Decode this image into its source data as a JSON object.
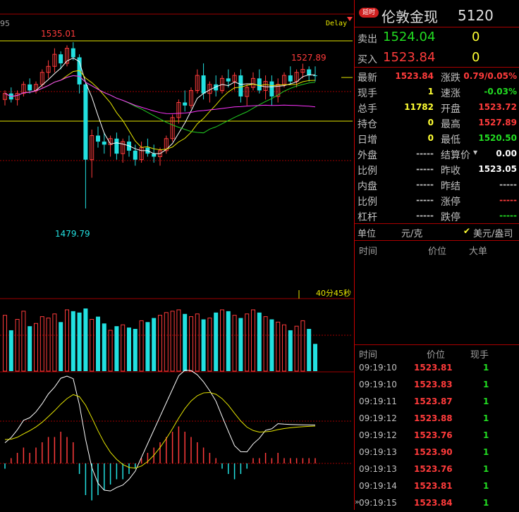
{
  "header": {
    "delay_badge": "延时",
    "instrument_name": "伦敦金现",
    "instrument_code": "5120",
    "delay_label": "Delay",
    "left_axis_fragment": "95"
  },
  "quotes": {
    "sell_label": "卖出",
    "sell_price": "1524.04",
    "sell_qty": "0",
    "buy_label": "买入",
    "buy_price": "1523.84",
    "buy_qty": "0"
  },
  "stats": {
    "left": [
      {
        "label": "最新",
        "value": "1523.84",
        "color": "#ff3b3b"
      },
      {
        "label": "现手",
        "value": "1",
        "color": "#ffff33"
      },
      {
        "label": "总手",
        "value": "11782",
        "color": "#ffff33"
      },
      {
        "label": "持仓",
        "value": "0",
        "color": "#ffff33"
      },
      {
        "label": "日增",
        "value": "0",
        "color": "#ffff33"
      },
      {
        "label": "外盘",
        "value": "-----",
        "color": "#c0c0c0"
      },
      {
        "label": "比例",
        "value": "-----",
        "color": "#c0c0c0"
      },
      {
        "label": "内盘",
        "value": "-----",
        "color": "#c0c0c0"
      },
      {
        "label": "比例",
        "value": "-----",
        "color": "#c0c0c0"
      },
      {
        "label": "杠杆",
        "value": "-----",
        "color": "#c0c0c0"
      }
    ],
    "right": [
      {
        "label": "涨跌",
        "value": "0.79/0.05%",
        "color": "#ff3b3b"
      },
      {
        "label": "速涨",
        "value": "-0.03%",
        "color": "#22dd22"
      },
      {
        "label": "开盘",
        "value": "1523.72",
        "color": "#ff3b3b"
      },
      {
        "label": "最高",
        "value": "1527.89",
        "color": "#ff3b3b"
      },
      {
        "label": "最低",
        "value": "1520.50",
        "color": "#22dd22"
      },
      {
        "label": "结算价",
        "value": "0.00",
        "color": "#ffffff"
      },
      {
        "label": "昨收",
        "value": "1523.05",
        "color": "#ffffff"
      },
      {
        "label": "昨结",
        "value": "-----",
        "color": "#c0c0c0"
      },
      {
        "label": "涨停",
        "value": "-----",
        "color": "#ff3b3b"
      },
      {
        "label": "跌停",
        "value": "-----",
        "color": "#22dd22"
      }
    ]
  },
  "unit_bar": {
    "unit_label": "单位",
    "unit_value": "元/克",
    "check": "✔",
    "alt_unit": "美元/盎司"
  },
  "big_orders": {
    "headers": [
      "时间",
      "价位",
      "大单"
    ]
  },
  "ticks": {
    "headers": [
      "时间",
      "价位",
      "现手"
    ],
    "rows": [
      {
        "time": "09:19:10",
        "price": "1523.81",
        "qty": "1"
      },
      {
        "time": "09:19:10",
        "price": "1523.83",
        "qty": "1"
      },
      {
        "time": "09:19:11",
        "price": "1523.87",
        "qty": "1"
      },
      {
        "time": "09:19:12",
        "price": "1523.88",
        "qty": "1"
      },
      {
        "time": "09:19:12",
        "price": "1523.76",
        "qty": "1"
      },
      {
        "time": "09:19:13",
        "price": "1523.90",
        "qty": "1"
      },
      {
        "time": "09:19:13",
        "price": "1523.76",
        "qty": "1"
      },
      {
        "time": "09:19:14",
        "price": "1523.81",
        "qty": "1"
      },
      {
        "time": "09:19:15",
        "price": "1523.84",
        "qty": "1"
      }
    ]
  },
  "chart": {
    "high_label": "1535.01",
    "low_label": "1479.79",
    "recent_high_label": "1527.89",
    "countdown": "40分45秒",
    "colors": {
      "up": "#ff3b3b",
      "down": "#22e0e0",
      "ma_white": "#ffffff",
      "ma_yellow": "#e6e600",
      "ma_green": "#22cc22",
      "ma_magenta": "#ff33ff",
      "grid": "#a00000"
    }
  },
  "chart_data": {
    "type": "candlestick",
    "price_high": 1535.01,
    "price_low": 1479.79,
    "recent_high": 1527.89,
    "candles": [
      {
        "o": 1516,
        "h": 1519,
        "l": 1514,
        "c": 1518
      },
      {
        "o": 1518,
        "h": 1520,
        "l": 1515,
        "c": 1516
      },
      {
        "o": 1516,
        "h": 1519,
        "l": 1514,
        "c": 1518
      },
      {
        "o": 1518,
        "h": 1522,
        "l": 1517,
        "c": 1521
      },
      {
        "o": 1521,
        "h": 1523,
        "l": 1518,
        "c": 1519
      },
      {
        "o": 1519,
        "h": 1522,
        "l": 1518,
        "c": 1521
      },
      {
        "o": 1521,
        "h": 1526,
        "l": 1520,
        "c": 1525
      },
      {
        "o": 1525,
        "h": 1529,
        "l": 1523,
        "c": 1527
      },
      {
        "o": 1527,
        "h": 1533,
        "l": 1525,
        "c": 1531
      },
      {
        "o": 1531,
        "h": 1532,
        "l": 1526,
        "c": 1528
      },
      {
        "o": 1528,
        "h": 1534,
        "l": 1527,
        "c": 1533
      },
      {
        "o": 1533,
        "h": 1535.01,
        "l": 1529,
        "c": 1530
      },
      {
        "o": 1530,
        "h": 1531,
        "l": 1518,
        "c": 1521
      },
      {
        "o": 1521,
        "h": 1522,
        "l": 1479.79,
        "c": 1496
      },
      {
        "o": 1496,
        "h": 1506,
        "l": 1490,
        "c": 1504
      },
      {
        "o": 1504,
        "h": 1507,
        "l": 1500,
        "c": 1502
      },
      {
        "o": 1502,
        "h": 1505,
        "l": 1498,
        "c": 1501
      },
      {
        "o": 1501,
        "h": 1504,
        "l": 1497,
        "c": 1503
      },
      {
        "o": 1503,
        "h": 1505,
        "l": 1496,
        "c": 1498
      },
      {
        "o": 1498,
        "h": 1503,
        "l": 1495,
        "c": 1502
      },
      {
        "o": 1502,
        "h": 1504,
        "l": 1497,
        "c": 1499
      },
      {
        "o": 1499,
        "h": 1501,
        "l": 1494,
        "c": 1496
      },
      {
        "o": 1496,
        "h": 1502,
        "l": 1495,
        "c": 1500
      },
      {
        "o": 1500,
        "h": 1503,
        "l": 1497,
        "c": 1498
      },
      {
        "o": 1498,
        "h": 1501,
        "l": 1495,
        "c": 1497
      },
      {
        "o": 1497,
        "h": 1500,
        "l": 1494,
        "c": 1499
      },
      {
        "o": 1499,
        "h": 1504,
        "l": 1498,
        "c": 1503
      },
      {
        "o": 1503,
        "h": 1511,
        "l": 1502,
        "c": 1510
      },
      {
        "o": 1510,
        "h": 1516,
        "l": 1508,
        "c": 1515
      },
      {
        "o": 1515,
        "h": 1519,
        "l": 1512,
        "c": 1514
      },
      {
        "o": 1514,
        "h": 1520,
        "l": 1513,
        "c": 1519
      },
      {
        "o": 1519,
        "h": 1526,
        "l": 1518,
        "c": 1524
      },
      {
        "o": 1524,
        "h": 1528,
        "l": 1516,
        "c": 1518
      },
      {
        "o": 1518,
        "h": 1522,
        "l": 1515,
        "c": 1521
      },
      {
        "o": 1521,
        "h": 1524,
        "l": 1517,
        "c": 1519
      },
      {
        "o": 1519,
        "h": 1524,
        "l": 1518,
        "c": 1523
      },
      {
        "o": 1523,
        "h": 1526,
        "l": 1520,
        "c": 1522
      },
      {
        "o": 1522,
        "h": 1525,
        "l": 1519,
        "c": 1524
      },
      {
        "o": 1524,
        "h": 1526,
        "l": 1515,
        "c": 1517
      },
      {
        "o": 1517,
        "h": 1521,
        "l": 1514,
        "c": 1520
      },
      {
        "o": 1520,
        "h": 1525,
        "l": 1519,
        "c": 1523
      },
      {
        "o": 1523,
        "h": 1526,
        "l": 1518,
        "c": 1519
      },
      {
        "o": 1519,
        "h": 1524,
        "l": 1516,
        "c": 1522
      },
      {
        "o": 1522,
        "h": 1524,
        "l": 1514,
        "c": 1517
      },
      {
        "o": 1517,
        "h": 1523,
        "l": 1515,
        "c": 1521
      },
      {
        "o": 1521,
        "h": 1525,
        "l": 1520,
        "c": 1524
      },
      {
        "o": 1524,
        "h": 1527,
        "l": 1521,
        "c": 1522
      },
      {
        "o": 1522,
        "h": 1526,
        "l": 1520,
        "c": 1525
      },
      {
        "o": 1525,
        "h": 1527.89,
        "l": 1523,
        "c": 1526
      },
      {
        "o": 1526,
        "h": 1527,
        "l": 1522,
        "c": 1524
      },
      {
        "o": 1524,
        "h": 1527,
        "l": 1522,
        "c": 1523.84
      }
    ],
    "volume": [
      41,
      30,
      38,
      44,
      33,
      35,
      40,
      39,
      42,
      36,
      45,
      44,
      43,
      46,
      38,
      40,
      35,
      30,
      33,
      34,
      32,
      31,
      37,
      36,
      39,
      41,
      43,
      44,
      45,
      42,
      40,
      42,
      38,
      39,
      43,
      45,
      44,
      41,
      39,
      42,
      45,
      43,
      40,
      38,
      36,
      34,
      30,
      33,
      37,
      31,
      20
    ],
    "macd_hist": [
      -1,
      1,
      2,
      3,
      2,
      3,
      4,
      5,
      5,
      6,
      5,
      4,
      -2,
      -6,
      -7,
      -6,
      -5,
      -4,
      -3,
      -3,
      -2,
      -1,
      1,
      2,
      3,
      4,
      5,
      6,
      7,
      6,
      5,
      4,
      3,
      2,
      1,
      -1,
      -2,
      -3,
      -2,
      -1,
      1,
      1,
      2,
      1,
      2,
      1,
      1,
      1,
      1,
      1,
      1
    ]
  }
}
